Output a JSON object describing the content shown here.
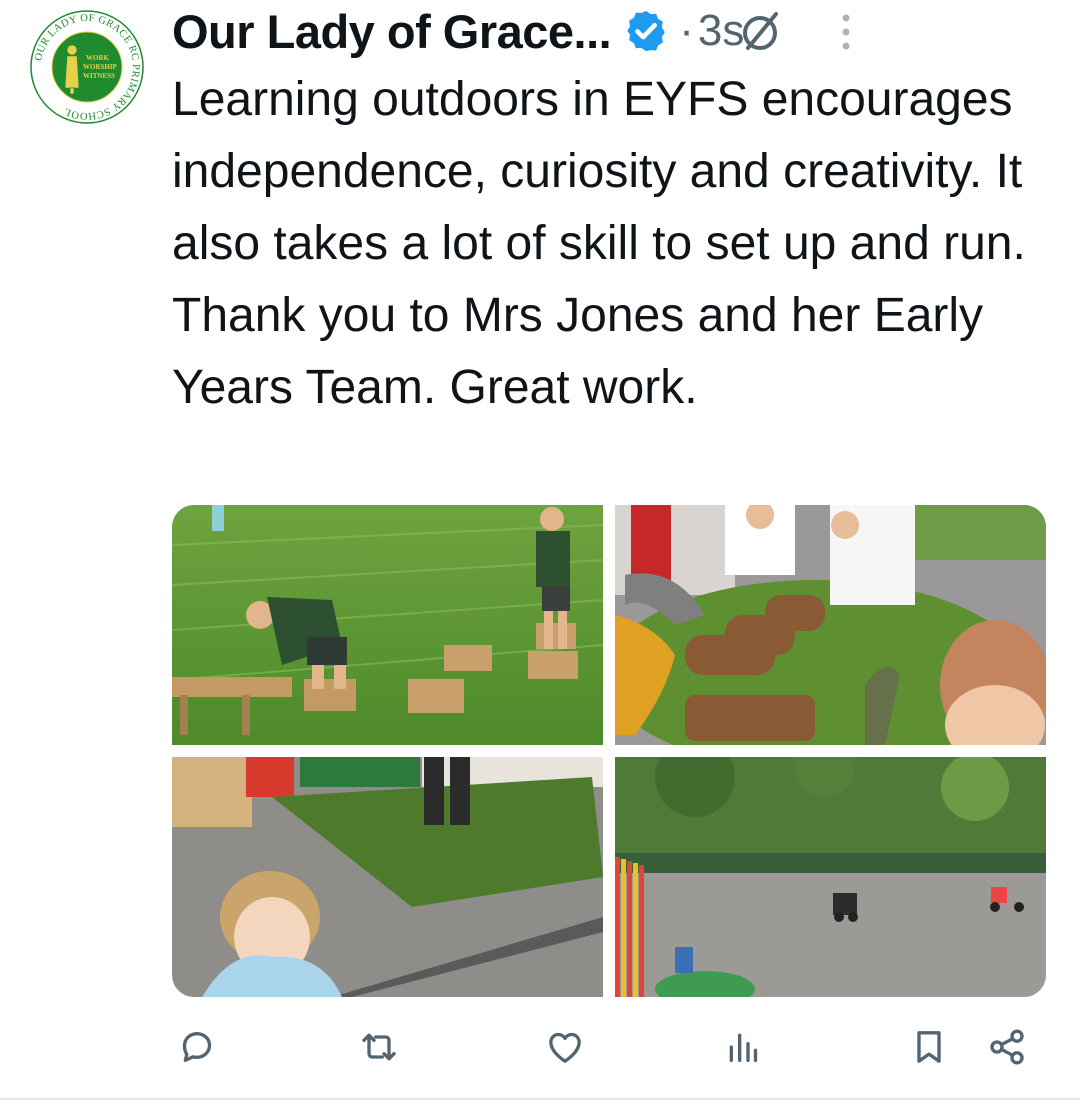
{
  "account": {
    "display_name": "Our Lady of Grace...",
    "time": "3s",
    "separator": "·",
    "verified": true,
    "logo_text_ring": "OUR LADY OF GRACE RC PRIMARY SCHOOL",
    "logo_motto": "WORK WORSHIP WITNESS",
    "logo_colors": {
      "green": "#1f8a2e",
      "gold": "#e8d04a"
    }
  },
  "tweet": {
    "text": "Learning outdoors in EYFS encourages independence, curiosity and creativity. It also takes a lot of skill to set up and run. Thank you to Mrs Jones and her Early Years Team. Great work."
  },
  "media": [
    {
      "icon": "photo-children-playing-on-grass"
    },
    {
      "icon": "photo-children-with-dinosaurs-and-logs"
    },
    {
      "icon": "photo-girl-on-playground-mat"
    },
    {
      "icon": "photo-playground-with-tricycles"
    }
  ],
  "actions": [
    {
      "icon": "reply-icon"
    },
    {
      "icon": "retweet-icon"
    },
    {
      "icon": "like-icon"
    },
    {
      "icon": "views-icon"
    },
    {
      "icon": "bookmark-icon"
    },
    {
      "icon": "share-icon"
    }
  ],
  "colors": {
    "verified_blue": "#1d9bf0",
    "text": "#0f1419",
    "secondary": "#536471",
    "icon": "#536471"
  }
}
